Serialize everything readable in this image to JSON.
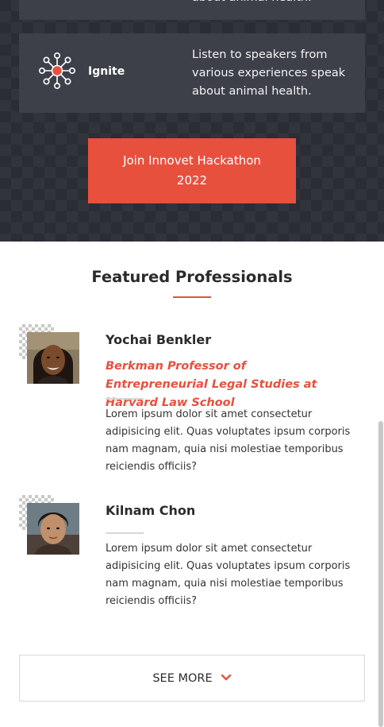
{
  "events": {
    "top_card_text": "about animal health.",
    "ignite_card": {
      "title": "Ignite",
      "text": "Listen to speakers from various experiences speak about animal health.",
      "icon": "network-hub-icon"
    },
    "cta_label": "Join Innovet Hackathon 2022"
  },
  "featured": {
    "title": "Featured Professionals",
    "professionals": [
      {
        "name": "Yochai Benkler",
        "role": "Berkman Professor of Entrepreneurial Legal Studies at Harvard Law School",
        "bio": "Lorem ipsum dolor sit amet consectetur adipisicing elit. Quas voluptates ipsum corporis nam magnam, quia nisi molestiae temporibus reiciendis officiis?"
      },
      {
        "name": "Kilnam Chon",
        "role": "",
        "bio": "Lorem ipsum dolor sit amet consectetur adipisicing elit. Quas voluptates ipsum corporis nam magnam, quia nisi molestiae temporibus reiciendis officiis?"
      }
    ],
    "see_more_label": "SEE MORE"
  },
  "colors": {
    "accent": "#e8503e",
    "dark_bg": "#2a2d34",
    "card_bg": "#3d4049"
  }
}
